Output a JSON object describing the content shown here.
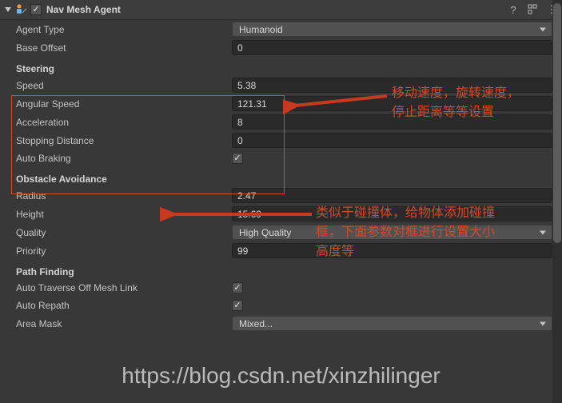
{
  "component": {
    "title": "Nav Mesh Agent",
    "enabled": true
  },
  "agentType": {
    "label": "Agent Type",
    "value": "Humanoid"
  },
  "baseOffset": {
    "label": "Base Offset",
    "value": "0"
  },
  "sections": {
    "steering": "Steering",
    "obstacle": "Obstacle Avoidance",
    "pathfinding": "Path Finding"
  },
  "speed": {
    "label": "Speed",
    "value": "5.38"
  },
  "angularSpeed": {
    "label": "Angular Speed",
    "value": "121.31"
  },
  "acceleration": {
    "label": "Acceleration",
    "value": "8"
  },
  "stoppingDistance": {
    "label": "Stopping Distance",
    "value": "0"
  },
  "autoBraking": {
    "label": "Auto Braking",
    "checked": true
  },
  "radius": {
    "label": "Radius",
    "value": "2.47"
  },
  "heightProp": {
    "label": "Height",
    "value": "15.69"
  },
  "quality": {
    "label": "Quality",
    "value": "High Quality"
  },
  "priority": {
    "label": "Priority",
    "value": "99"
  },
  "autoTraverse": {
    "label": "Auto Traverse Off Mesh Link",
    "checked": true
  },
  "autoRepath": {
    "label": "Auto Repath",
    "checked": true
  },
  "areaMask": {
    "label": "Area Mask",
    "value": "Mixed..."
  },
  "annotations": {
    "steering": "移动速度，旋转速度，停止距离等等设置",
    "steeringL1": "移动速度，旋转速度，",
    "steeringL2": "停止距离等等设置",
    "obstacle": "类似于碰撞体，给物体添加碰撞框，下面参数对框进行设置大小高度等",
    "obstacleL1": "类似于碰撞体，给物体添加碰撞",
    "obstacleL2": "框，下面参数对框进行设置大小",
    "obstacleL3": "高度等"
  },
  "watermark": "https://blog.csdn.net/xinzhilinger"
}
